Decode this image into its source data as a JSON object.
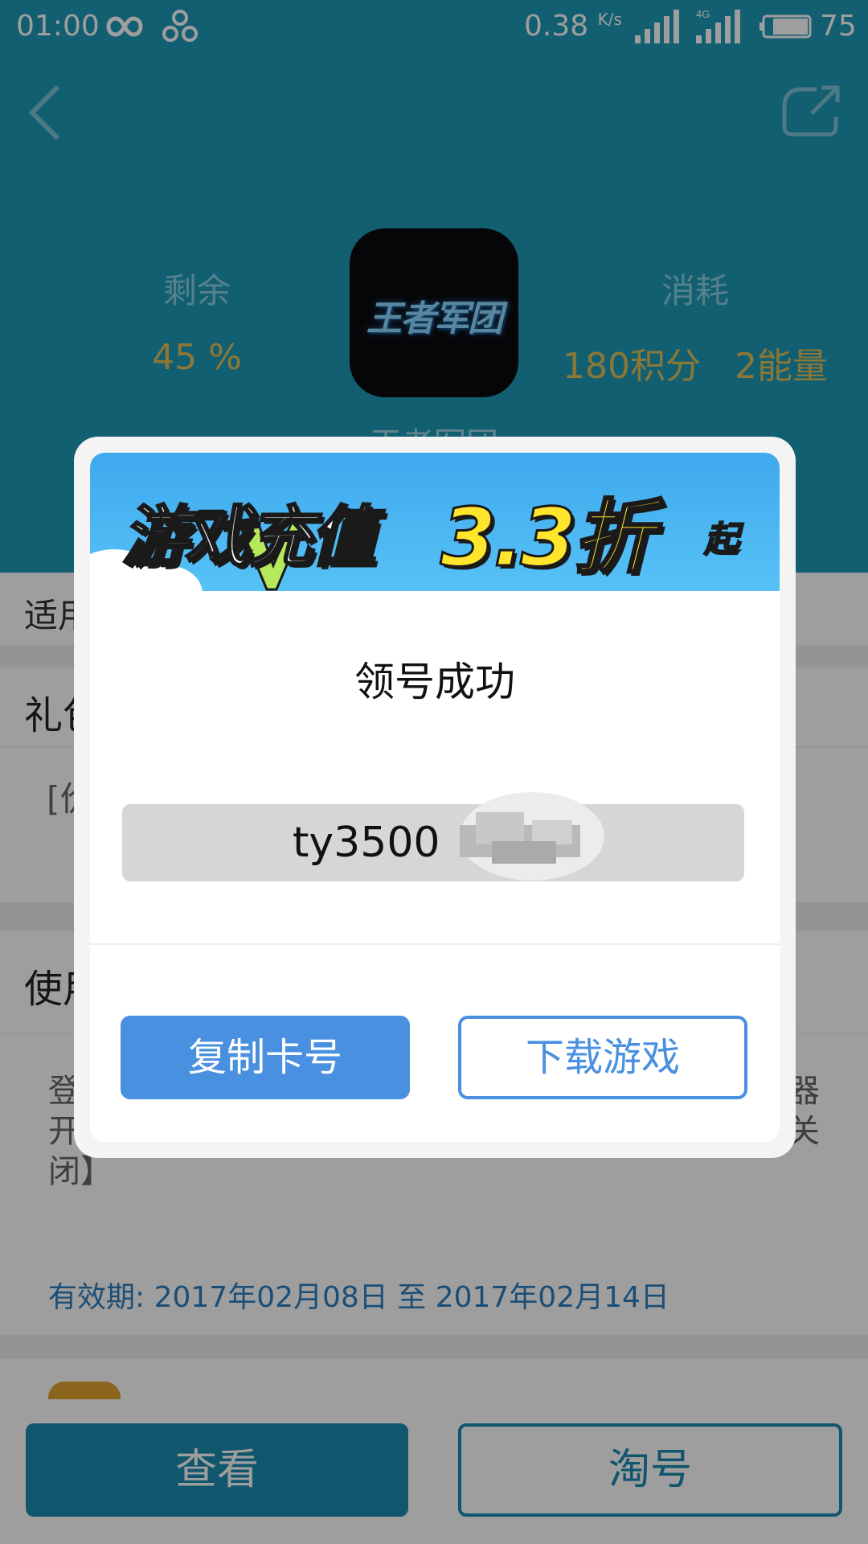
{
  "status_bar": {
    "time": "01:00",
    "net_speed": "0.38",
    "net_speed_unit": "K/s",
    "battery": "75"
  },
  "header": {
    "remaining_label": "剩余",
    "remaining_value": "45 %",
    "consume_label": "消耗",
    "consume_value": "180积分   2能量",
    "game_logo_text": "王者军团",
    "game_name_partial": "王者军团"
  },
  "sections": {
    "apply_label": "适用",
    "gift_title": "礼包",
    "gift_content": "[价",
    "usage_title": "使用",
    "usage_lines": [
      "登",
      "开",
      "闭】"
    ],
    "usage_right_lines": [
      "器",
      "关"
    ],
    "validity": "有效期: 2017年02月08日 至 2017年02月14日"
  },
  "bottom_bar": {
    "check_label": "查看",
    "tao_label": "淘号"
  },
  "dialog": {
    "banner_text": "游戏充值",
    "banner_discount": "3.3折",
    "banner_suffix": "起",
    "title": "领号成功",
    "code_visible": "ty3500",
    "copy_label": "复制卡号",
    "download_label": "下载游戏"
  },
  "colors": {
    "header_bg": "#1d99b6",
    "accent_blue": "#4a90e0",
    "gold": "#e0c15a"
  }
}
